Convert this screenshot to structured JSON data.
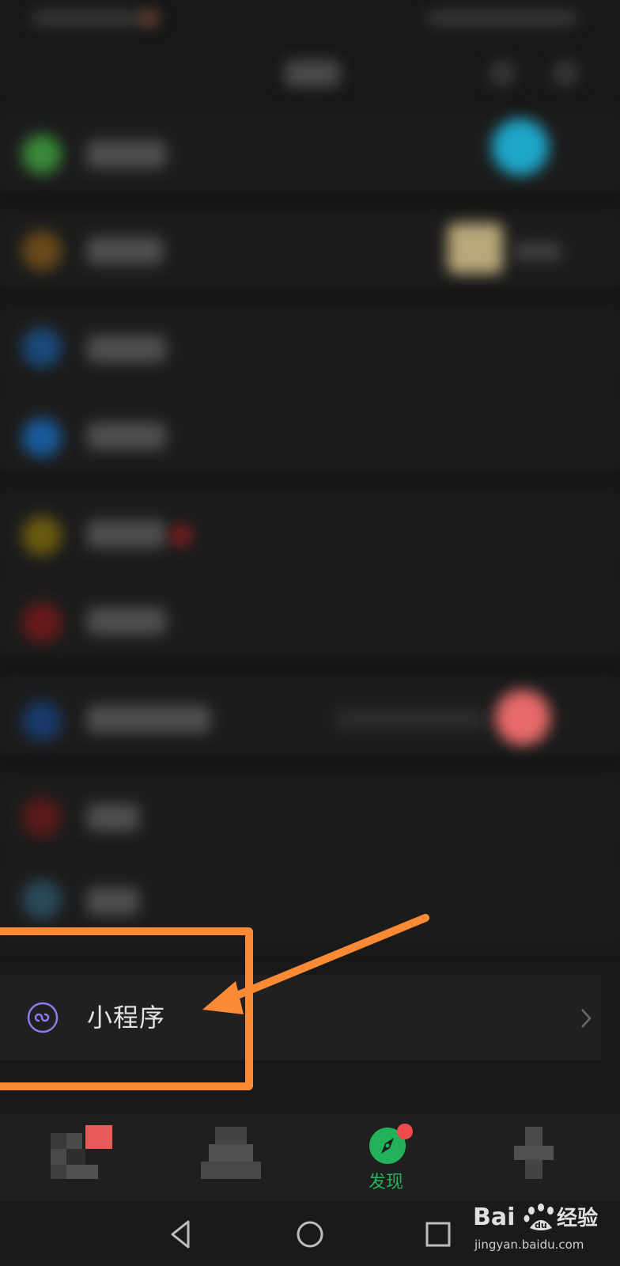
{
  "colors": {
    "background": "#181818",
    "accent_green": "#22b35a",
    "annotation_orange": "#fb8a36",
    "badge_red": "#f04a4a",
    "mini_program_icon": "#8a7cf0"
  },
  "list": {
    "mini_program": {
      "icon": "mini-program-link-icon",
      "label": "小程序",
      "chevron": "chevron-right-icon"
    }
  },
  "tabbar": {
    "active_tab": {
      "icon": "compass-icon",
      "label": "发现",
      "has_badge": true
    }
  },
  "watermark": {
    "brand_text": "Bai",
    "brand_suffix": "经验",
    "url": "jingyan.baidu.com"
  }
}
